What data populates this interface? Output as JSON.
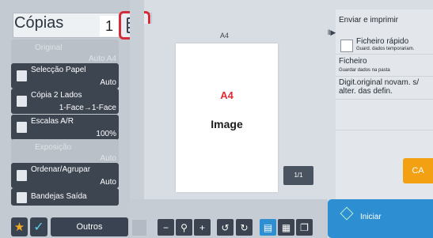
{
  "copies": {
    "label": "Cópias",
    "count": "1"
  },
  "functions": [
    {
      "name": "Original",
      "value": "Auto   A4",
      "enabled": false
    },
    {
      "name": "Selecção Papel",
      "value": "Auto",
      "enabled": true
    },
    {
      "name": "Cópia 2 Lados",
      "value": "1-Face→1-Face",
      "enabled": true
    },
    {
      "name": "Escalas A/R",
      "value": "100%",
      "enabled": true
    },
    {
      "name": "Exposição",
      "value": "Auto",
      "enabled": false
    },
    {
      "name": "Ordenar/Agrupar",
      "value": "Auto",
      "enabled": true
    },
    {
      "name": "Bandejas Saída",
      "value": "",
      "enabled": true
    }
  ],
  "bottom_left": {
    "others_label": "Outros"
  },
  "preview": {
    "paper_size_top": "A4",
    "paper_size_center": "A4",
    "image_label": "Image",
    "page_count": "1/1"
  },
  "right_panel": {
    "send_print": "Enviar e imprimir",
    "quick_file": "Ficheiro rápido",
    "quick_file_sub": "Guard. dados temporariam.",
    "file": "Ficheiro",
    "file_sub": "Guardar dados na pasta",
    "digit_original": "Digit.original novam. s/ alter. das defin.",
    "ca_label": "CA",
    "start_label": "Iniciar"
  },
  "colors": {
    "accent_red": "#d32d3c",
    "ca_orange": "#f4a013",
    "start_blue": "#2d8fd2",
    "dark_button": "#3d4551"
  }
}
